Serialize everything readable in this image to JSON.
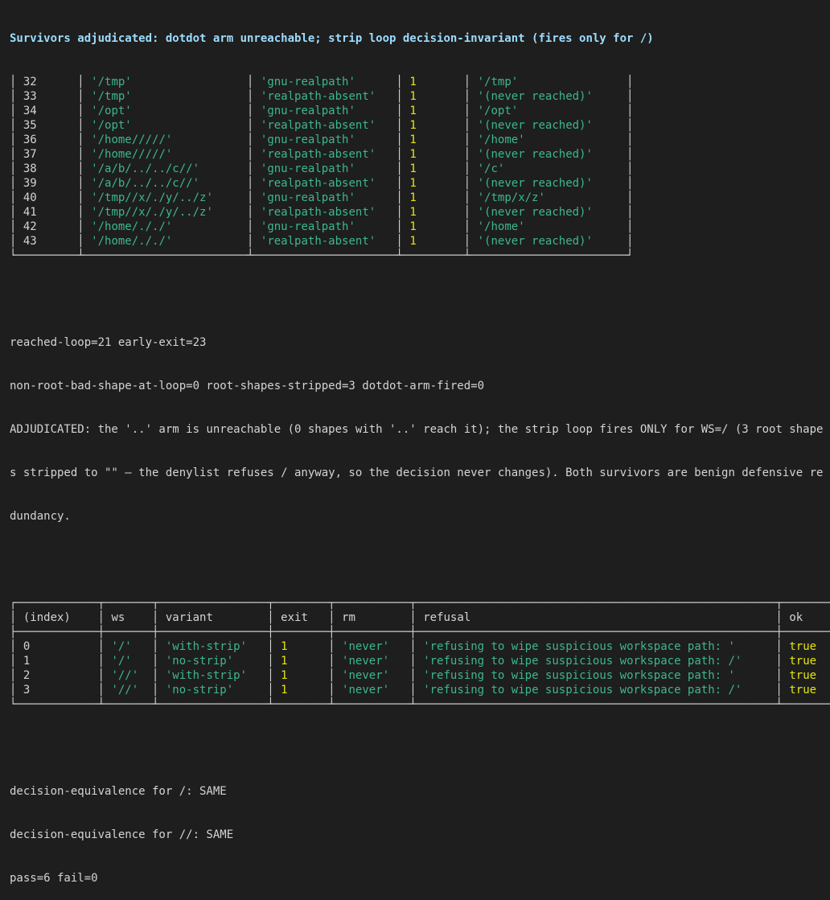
{
  "header": "Survivors adjudicated: dotdot arm unreachable; strip loop decision-invariant (fires only for /)",
  "table1": {
    "rows": [
      {
        "idx": "32",
        "input": "'/tmp'",
        "method": "'gnu-realpath'",
        "exit": "1",
        "result": "'/tmp'"
      },
      {
        "idx": "33",
        "input": "'/tmp'",
        "method": "'realpath-absent'",
        "exit": "1",
        "result": "'(never reached)'"
      },
      {
        "idx": "34",
        "input": "'/opt'",
        "method": "'gnu-realpath'",
        "exit": "1",
        "result": "'/opt'"
      },
      {
        "idx": "35",
        "input": "'/opt'",
        "method": "'realpath-absent'",
        "exit": "1",
        "result": "'(never reached)'"
      },
      {
        "idx": "36",
        "input": "'/home/////'",
        "method": "'gnu-realpath'",
        "exit": "1",
        "result": "'/home'"
      },
      {
        "idx": "37",
        "input": "'/home/////'",
        "method": "'realpath-absent'",
        "exit": "1",
        "result": "'(never reached)'"
      },
      {
        "idx": "38",
        "input": "'/a/b/../../c//'",
        "method": "'gnu-realpath'",
        "exit": "1",
        "result": "'/c'"
      },
      {
        "idx": "39",
        "input": "'/a/b/../../c//'",
        "method": "'realpath-absent'",
        "exit": "1",
        "result": "'(never reached)'"
      },
      {
        "idx": "40",
        "input": "'/tmp//x/./y/../z'",
        "method": "'gnu-realpath'",
        "exit": "1",
        "result": "'/tmp/x/z'"
      },
      {
        "idx": "41",
        "input": "'/tmp//x/./y/../z'",
        "method": "'realpath-absent'",
        "exit": "1",
        "result": "'(never reached)'"
      },
      {
        "idx": "42",
        "input": "'/home/././'",
        "method": "'gnu-realpath'",
        "exit": "1",
        "result": "'/home'"
      },
      {
        "idx": "43",
        "input": "'/home/././'",
        "method": "'realpath-absent'",
        "exit": "1",
        "result": "'(never reached)'"
      }
    ]
  },
  "summary": {
    "line1": "reached-loop=21 early-exit=23",
    "line2": "non-root-bad-shape-at-loop=0 root-shapes-stripped=3 dotdot-arm-fired=0",
    "adj1": "ADJUDICATED: the '..' arm is unreachable (0 shapes with '..' reach it); the strip loop fires ONLY for WS=/ (3 root shape",
    "adj2": "s stripped to \"\" — the denylist refuses / anyway, so the decision never changes). Both survivors are benign defensive re",
    "adj3": "dundancy."
  },
  "table2": {
    "headers": {
      "index": "(index)",
      "ws": "ws",
      "variant": "variant",
      "exit": "exit",
      "rm": "rm",
      "refusal": "refusal",
      "ok": "ok"
    },
    "rows": [
      {
        "index": "0",
        "ws": "'/'",
        "variant": "'with-strip'",
        "exit": "1",
        "rm": "'never'",
        "refusal": "'refusing to wipe suspicious workspace path: '",
        "ok": "true"
      },
      {
        "index": "1",
        "ws": "'/'",
        "variant": "'no-strip'",
        "exit": "1",
        "rm": "'never'",
        "refusal": "'refusing to wipe suspicious workspace path: /'",
        "ok": "true"
      },
      {
        "index": "2",
        "ws": "'//'",
        "variant": "'with-strip'",
        "exit": "1",
        "rm": "'never'",
        "refusal": "'refusing to wipe suspicious workspace path: '",
        "ok": "true"
      },
      {
        "index": "3",
        "ws": "'//'",
        "variant": "'no-strip'",
        "exit": "1",
        "rm": "'never'",
        "refusal": "'refusing to wipe suspicious workspace path: /'",
        "ok": "true"
      }
    ]
  },
  "footer": {
    "l1": "decision-equivalence for /: SAME",
    "l2": "decision-equivalence for //: SAME",
    "l3": "pass=6 fail=0"
  },
  "colors": {
    "background": "#1e1e1e",
    "header": "#9cdcfe",
    "string": "#3cb88a",
    "number": "#e5e510",
    "text": "#d4d4d4"
  }
}
